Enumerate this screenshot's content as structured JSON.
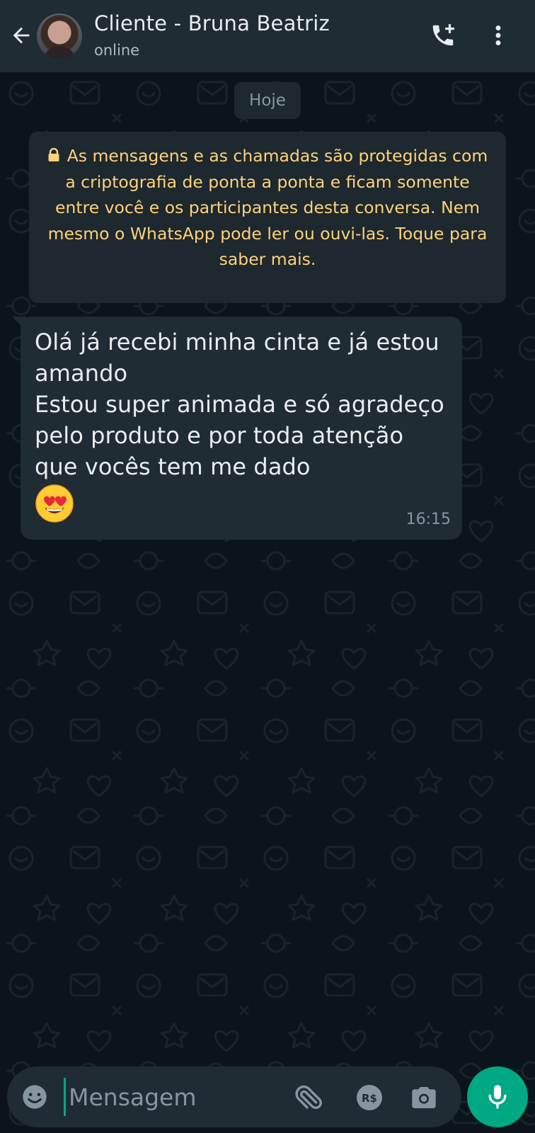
{
  "header": {
    "title": "Cliente - Bruna Beatriz",
    "status": "online",
    "icons": {
      "back": "arrow-left-icon",
      "call": "add-call-icon",
      "menu": "more-vert-icon"
    }
  },
  "chat": {
    "date_chip": "Hoje",
    "encryption_notice": "As mensagens e as chamadas são protegidas com a criptografia de ponta a ponta e ficam somente entre você e os participantes desta conversa. Nem mesmo o WhatsApp pode ler ou ouvi-las. Toque para saber mais.",
    "messages": [
      {
        "direction": "incoming",
        "text": "Olá já recebi minha cinta e já estou amando\nEstou super animada e só agradeço pelo produto e por toda atenção que vocês tem me dado",
        "emoji": "smiling-face-with-heart-eyes",
        "time": "16:15"
      }
    ]
  },
  "composer": {
    "placeholder": "Mensagem",
    "icons": {
      "emoji": "emoji-icon",
      "attach": "paperclip-icon",
      "payment": "payment-brl-icon",
      "camera": "camera-icon",
      "mic": "mic-icon"
    },
    "payment_label": "R$"
  },
  "colors": {
    "background": "#0b141a",
    "header": "#1f2c34",
    "bubble_incoming": "#1f2c34",
    "system_chip": "#1d282f",
    "notice_text": "#ffd279",
    "accent": "#00a884"
  }
}
